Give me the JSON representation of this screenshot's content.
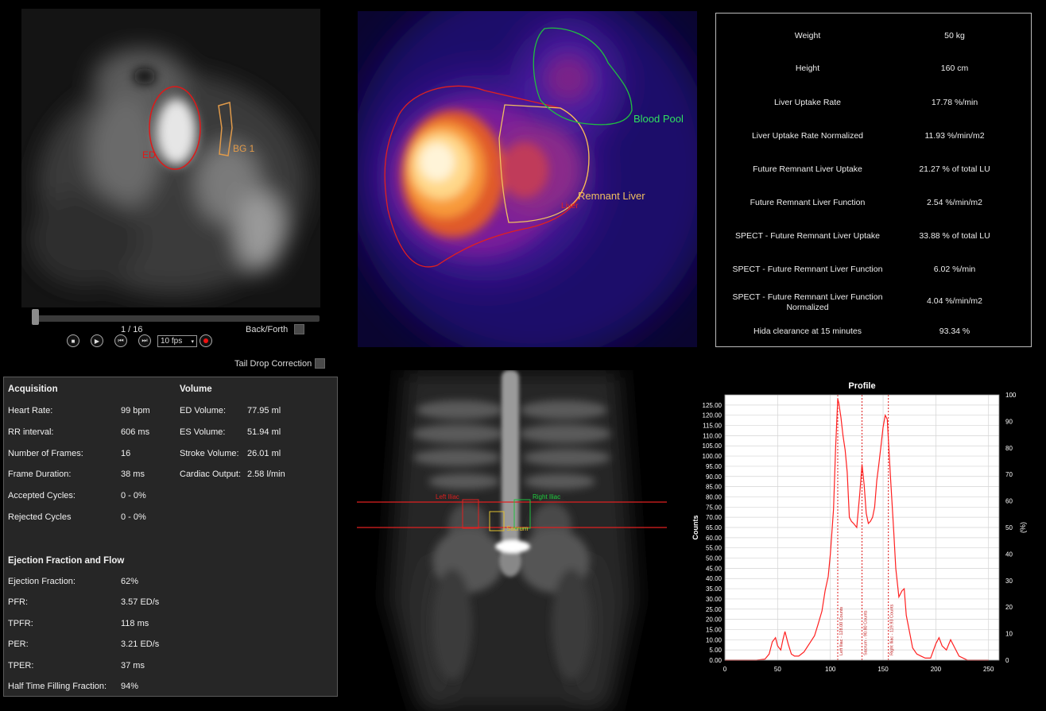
{
  "cine": {
    "labels": {
      "ed": "ED",
      "bg": "BG 1"
    },
    "frame_counter": "1 / 16",
    "fps": "10 fps",
    "back_forth_label": "Back/Forth",
    "tail_drop_label": "Tail Drop Correction",
    "progress": 0.0
  },
  "liver_image": {
    "labels": {
      "blood_pool": "Blood Pool",
      "remnant": "Remnant Liver",
      "liver": "Liver"
    }
  },
  "stats": [
    {
      "label": "Weight",
      "value": "50 kg"
    },
    {
      "label": "Height",
      "value": "160 cm"
    },
    {
      "label": "Liver Uptake Rate",
      "value": "17.78 %/min"
    },
    {
      "label": "Liver Uptake Rate Normalized",
      "value": "11.93 %/min/m2"
    },
    {
      "label": "Future Remnant Liver Uptake",
      "value": "21.27 % of total LU"
    },
    {
      "label": "Future Remnant Liver Function",
      "value": "2.54 %/min/m2"
    },
    {
      "label": "SPECT - Future Remnant Liver Uptake",
      "value": "33.88 % of total LU"
    },
    {
      "label": "SPECT - Future Remnant Liver Function",
      "value": "6.02 %/min"
    },
    {
      "label": "SPECT - Future Remnant Liver Function Normalized",
      "value": "4.04 %/min/m2"
    },
    {
      "label": "Hida clearance at 15 minutes",
      "value": "93.34 %"
    }
  ],
  "results": {
    "acquisition_header": "Acquisition",
    "volume_header": "Volume",
    "ef_header": "Ejection Fraction and Flow",
    "acquisition": [
      {
        "k": "Heart Rate:",
        "v": "99 bpm"
      },
      {
        "k": "RR interval:",
        "v": "606 ms"
      },
      {
        "k": "Number of Frames:",
        "v": "16"
      },
      {
        "k": "Frame Duration:",
        "v": "38 ms"
      },
      {
        "k": "Accepted Cycles:",
        "v": "0 - 0%"
      },
      {
        "k": "Rejected Cycles",
        "v": "0 - 0%"
      }
    ],
    "volume": [
      {
        "k": "ED Volume:",
        "v": "77.95 ml"
      },
      {
        "k": "ES Volume:",
        "v": "51.94 ml"
      },
      {
        "k": "Stroke Volume:",
        "v": "26.01 ml"
      },
      {
        "k": "Cardiac Output:",
        "v": "2.58 l/min"
      }
    ],
    "ef": [
      {
        "k": "Ejection Fraction:",
        "v": "62%"
      },
      {
        "k": "PFR:",
        "v": "3.57 ED/s"
      },
      {
        "k": "TPFR:",
        "v": "118 ms"
      },
      {
        "k": "PER:",
        "v": "3.21 ED/s"
      },
      {
        "k": "TPER:",
        "v": "37 ms"
      },
      {
        "k": "Half Time Filling Fraction:",
        "v": "94%"
      }
    ]
  },
  "bone_scan": {
    "labels": {
      "left_iliac": "Left Iliac",
      "right_iliac": "Right Iliac",
      "sacrum": "Sacrum"
    }
  },
  "chart_data": {
    "type": "line",
    "title": "Profile",
    "ylabel": "Counts",
    "y2label": "(%)",
    "xlim": [
      0,
      260
    ],
    "ylim": [
      0,
      130
    ],
    "y2lim": [
      0,
      100
    ],
    "x_ticks": [
      "0",
      "50",
      "100",
      "150",
      "200",
      "250"
    ],
    "x_tick_values": [
      0,
      50,
      100,
      150,
      200,
      250
    ],
    "y_ticks": [
      "0.00",
      "5.00",
      "10.00",
      "15.00",
      "20.00",
      "25.00",
      "30.00",
      "35.00",
      "40.00",
      "45.00",
      "50.00",
      "55.00",
      "60.00",
      "65.00",
      "70.00",
      "75.00",
      "80.00",
      "85.00",
      "90.00",
      "95.00",
      "100.00",
      "105.00",
      "110.00",
      "115.00",
      "120.00",
      "125.00"
    ],
    "y2_ticks": [
      "0",
      "10",
      "20",
      "30",
      "40",
      "50",
      "60",
      "70",
      "80",
      "90",
      "100"
    ],
    "grid": true,
    "series": [
      {
        "color": "#ff2020",
        "x": [
          0,
          10,
          20,
          30,
          38,
          42,
          45,
          48,
          50,
          53,
          55,
          57,
          60,
          63,
          66,
          70,
          75,
          80,
          85,
          88,
          92,
          95,
          98,
          100,
          103,
          105,
          107,
          108,
          110,
          112,
          114,
          116,
          118,
          120,
          122,
          125,
          128,
          130,
          132,
          134,
          136,
          138,
          140,
          142,
          144,
          146,
          148,
          150,
          152,
          154,
          155,
          157,
          160,
          162,
          165,
          168,
          170,
          172,
          175,
          178,
          182,
          186,
          190,
          195,
          200,
          203,
          206,
          210,
          214,
          218,
          222,
          230,
          240,
          250
        ],
        "y": [
          0,
          0,
          0,
          0,
          0.5,
          3,
          9,
          11,
          7,
          5,
          10,
          14,
          8,
          3,
          2,
          2,
          4,
          8,
          12,
          17,
          24,
          34,
          41,
          52,
          74,
          104,
          128,
          126,
          119,
          110,
          103,
          92,
          70,
          68,
          67,
          65,
          82,
          96,
          86,
          72,
          67,
          68,
          70,
          75,
          88,
          96,
          105,
          114,
          120,
          118,
          108,
          90,
          64,
          45,
          31,
          34,
          35,
          22,
          14,
          6,
          3,
          2,
          1,
          1,
          8,
          11,
          7,
          5,
          10,
          6,
          2,
          0,
          0,
          0
        ]
      }
    ],
    "markers": [
      {
        "x": 107,
        "label": "Left Iliac - 128.00 Counts"
      },
      {
        "x": 130,
        "label": "Sacrum - 90.80 Counts"
      },
      {
        "x": 155,
        "label": "Right Iliac - 119.93 Counts"
      }
    ]
  }
}
